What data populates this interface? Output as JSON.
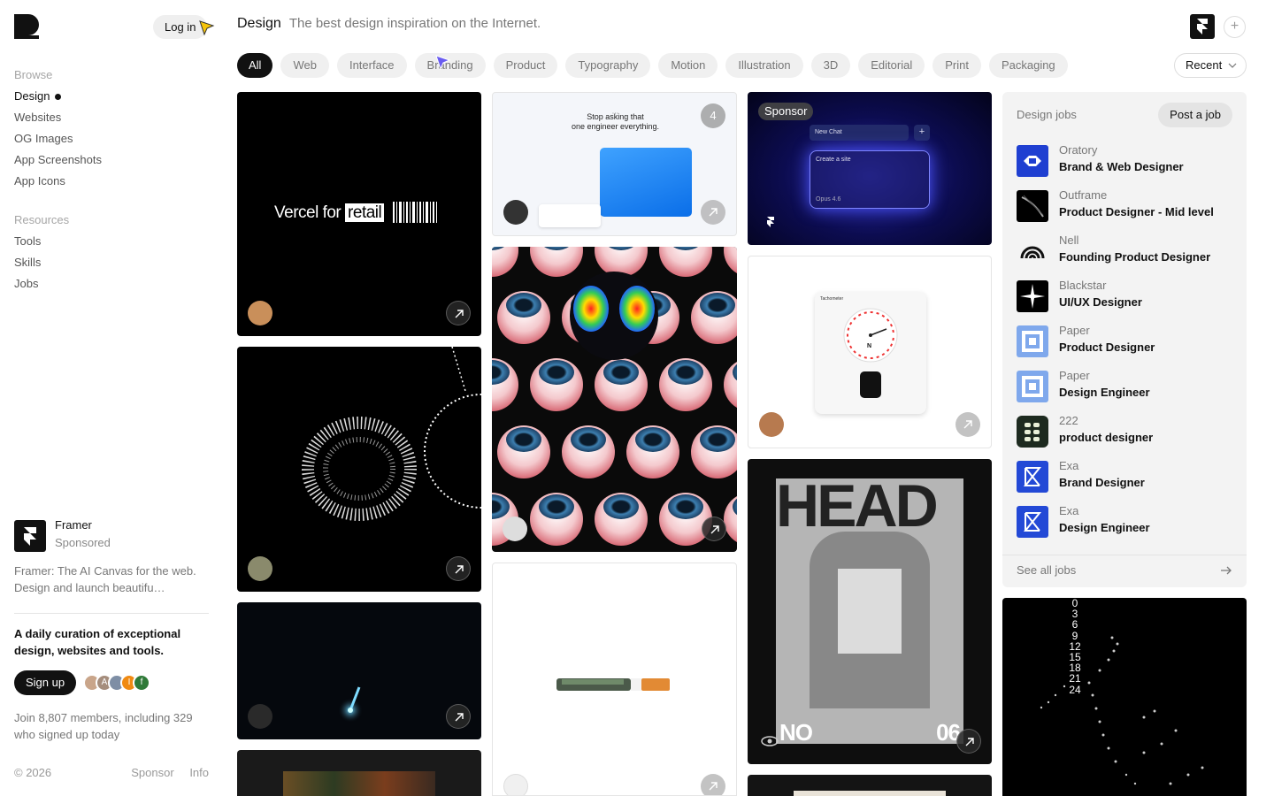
{
  "sidebar": {
    "login_label": "Log in",
    "browse_heading": "Browse",
    "browse_items": [
      "Design",
      "Websites",
      "OG Images",
      "App Screenshots",
      "App Icons"
    ],
    "resources_heading": "Resources",
    "resources_items": [
      "Tools",
      "Skills",
      "Jobs"
    ],
    "sponsor": {
      "name": "Framer",
      "sub": "Sponsored",
      "desc": "Framer: The AI Canvas for the web. Design and launch beautifu…"
    },
    "tagline": "A daily curation of exceptional design, websites and tools.",
    "signup_label": "Sign up",
    "members": "Join 8,807 members, including 329 who signed up today",
    "footer": {
      "copyright": "© 2026",
      "sponsor_link": "Sponsor",
      "info_link": "Info"
    }
  },
  "header": {
    "title": "Design",
    "subtitle": "The best design inspiration on the Internet."
  },
  "filters": [
    "All",
    "Web",
    "Interface",
    "Branding",
    "Product",
    "Typography",
    "Motion",
    "Illustration",
    "3D",
    "Editorial",
    "Print",
    "Packaging"
  ],
  "sort": {
    "selected": "Recent"
  },
  "cards": {
    "vercel": {
      "text_a": "Vercel for",
      "text_b": "retail"
    },
    "landing": {
      "count": "4",
      "headline_small": "Stop asking that",
      "headline": "one engineer everything."
    },
    "sponsor_card": {
      "badge": "Sponsor",
      "chat_title": "New Chat",
      "chat_input": "Create a site",
      "model": "Opus 4.6"
    },
    "tachometer": {
      "title": "Tachometer",
      "letter": "N"
    },
    "poster": {
      "head": "HEAD",
      "no": "NO",
      "num": "06"
    }
  },
  "jobs": {
    "heading": "Design jobs",
    "post_label": "Post a job",
    "items": [
      {
        "company": "Oratory",
        "title": "Brand & Web Designer"
      },
      {
        "company": "Outframe",
        "title": "Product Designer - Mid level"
      },
      {
        "company": "Nell",
        "title": "Founding Product Designer"
      },
      {
        "company": "Blackstar",
        "title": "UI/UX Designer"
      },
      {
        "company": "Paper",
        "title": "Product Designer"
      },
      {
        "company": "Paper",
        "title": "Design Engineer"
      },
      {
        "company": "222",
        "title": "product designer"
      },
      {
        "company": "Exa",
        "title": "Brand Designer"
      },
      {
        "company": "Exa",
        "title": "Design Engineer"
      }
    ],
    "see_all": "See all jobs"
  },
  "numbers_card": [
    "0",
    "3",
    "6",
    "9",
    "12",
    "15",
    "18",
    "21",
    "24"
  ],
  "colors": {
    "accent": "#111111",
    "chip_bg": "#f0f0f0",
    "panel_bg": "#f3f3f3",
    "oratory": "#1f3fd1",
    "paper": "#7fa8ec",
    "exa": "#2349d6"
  }
}
